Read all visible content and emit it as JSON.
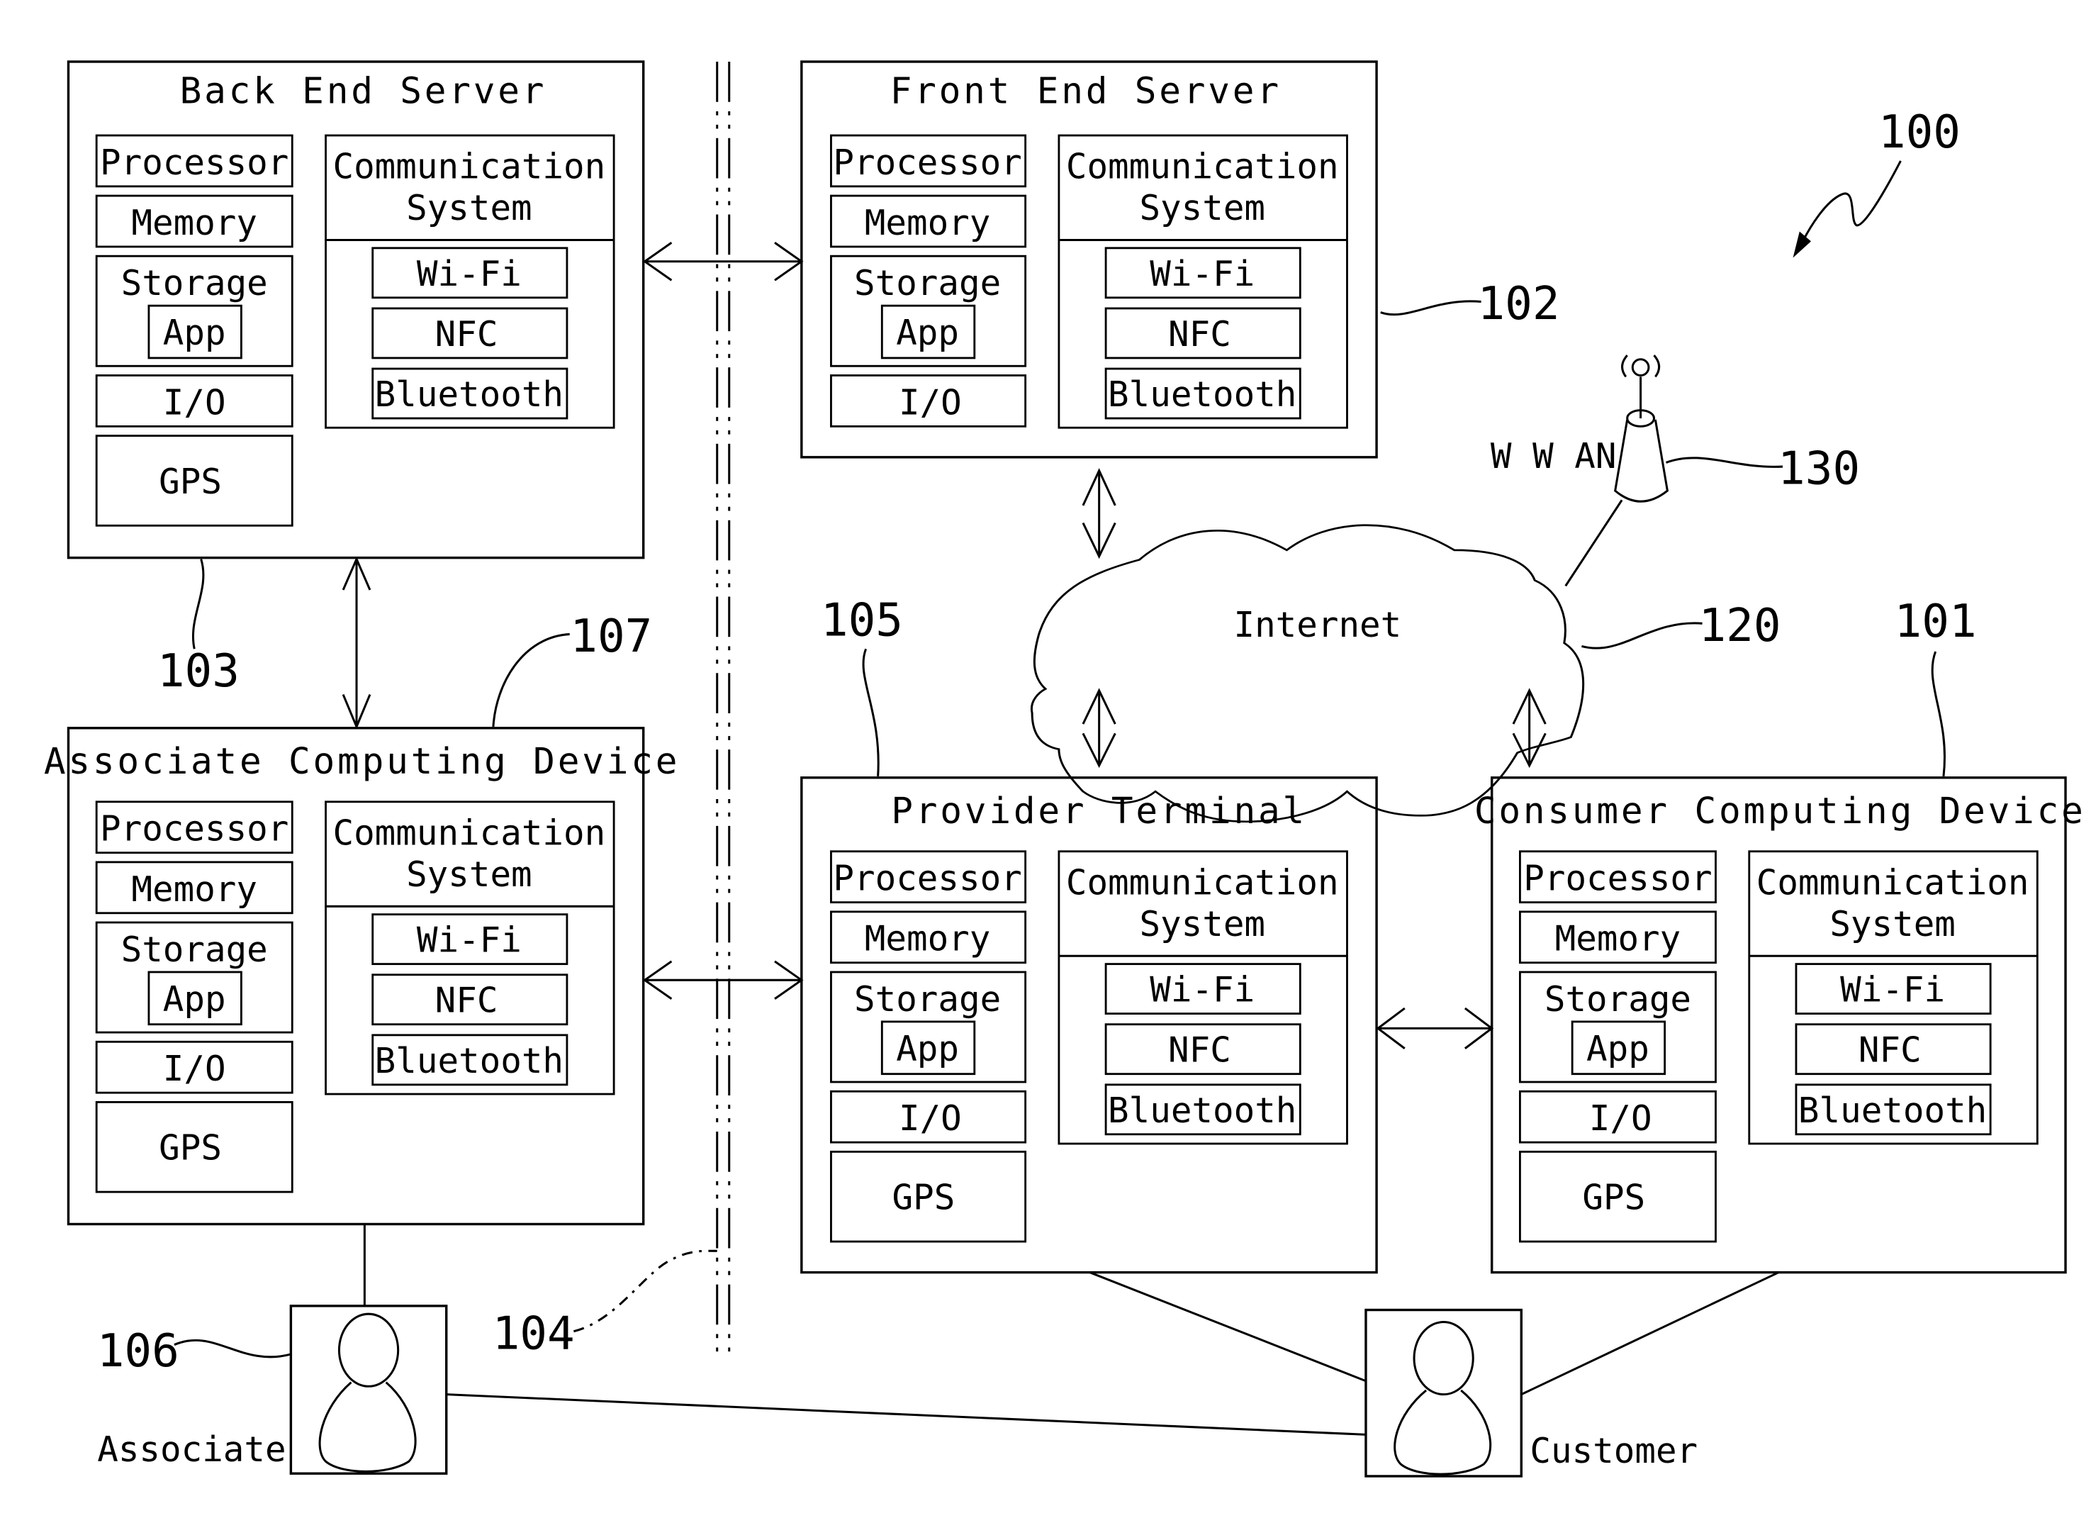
{
  "figure_ref": "100",
  "devices": [
    {
      "id": "back-end-server",
      "title": "Back End Server",
      "ref": "103",
      "components": [
        "Processor",
        "Memory",
        "Storage",
        "App",
        "I/O",
        "GPS"
      ],
      "comm": {
        "title_line1": "Communication",
        "title_line2": "System",
        "items": [
          "Wi-Fi",
          "NFC",
          "Bluetooth"
        ]
      }
    },
    {
      "id": "front-end-server",
      "title": "Front End Server",
      "ref": "102",
      "components": [
        "Processor",
        "Memory",
        "Storage",
        "App",
        "I/O"
      ],
      "comm": {
        "title_line1": "Communication",
        "title_line2": "System",
        "items": [
          "Wi-Fi",
          "NFC",
          "Bluetooth"
        ]
      }
    },
    {
      "id": "associate-computing-device",
      "title": "Associate Computing Device",
      "ref": "107",
      "components": [
        "Processor",
        "Memory",
        "Storage",
        "App",
        "I/O",
        "GPS"
      ],
      "comm": {
        "title_line1": "Communication",
        "title_line2": "System",
        "items": [
          "Wi-Fi",
          "NFC",
          "Bluetooth"
        ]
      }
    },
    {
      "id": "provider-terminal",
      "title": "Provider Terminal",
      "ref": "105",
      "components": [
        "Processor",
        "Memory",
        "Storage",
        "App",
        "I/O",
        "GPS"
      ],
      "comm": {
        "title_line1": "Communication",
        "title_line2": "System",
        "items": [
          "Wi-Fi",
          "NFC",
          "Bluetooth"
        ]
      }
    },
    {
      "id": "consumer-computing-device",
      "title": "Consumer Computing Device",
      "ref": "101",
      "components": [
        "Processor",
        "Memory",
        "Storage",
        "App",
        "I/O",
        "GPS"
      ],
      "comm": {
        "title_line1": "Communication",
        "title_line2": "System",
        "items": [
          "Wi-Fi",
          "NFC",
          "Bluetooth"
        ]
      }
    }
  ],
  "network": {
    "label": "Internet",
    "ref": "120"
  },
  "wwan": {
    "label": "W W AN",
    "ref": "130"
  },
  "boundary": {
    "ref": "104"
  },
  "people": [
    {
      "id": "associate",
      "label": "Associate",
      "ref": "106"
    },
    {
      "id": "customer",
      "label": "Customer"
    }
  ]
}
